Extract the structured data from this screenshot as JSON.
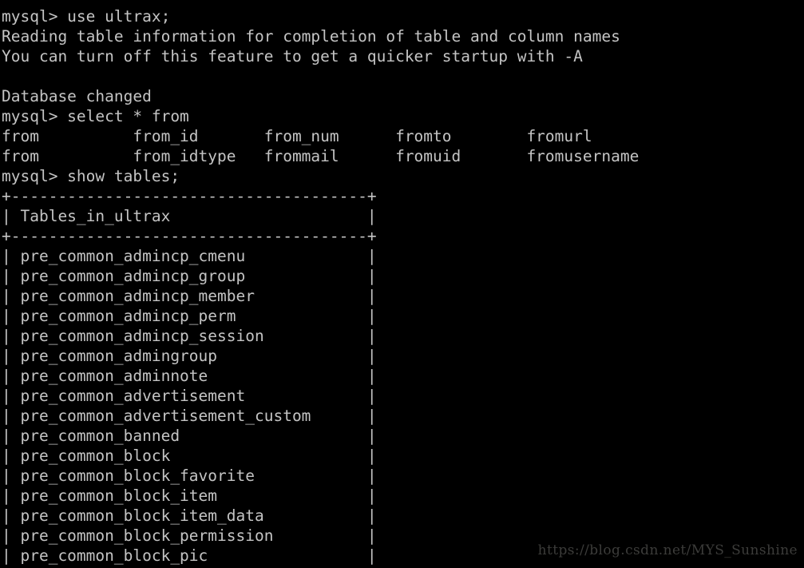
{
  "terminal": {
    "app": "mysql-client-terminal",
    "background_color": "#000000",
    "foreground_color": "#c4c4c4",
    "prompt": "mysql>",
    "lines": [
      "mysql> use ultrax;",
      "Reading table information for completion of table and column names",
      "You can turn off this feature to get a quicker startup with -A",
      "",
      "Database changed",
      "mysql> select * from",
      "from          from_id       from_num      fromto        fromurl",
      "from          from_idtype   frommail      fromuid       fromusername",
      "mysql> show tables;",
      "+--------------------------------------+",
      "| Tables_in_ultrax                     |",
      "+--------------------------------------+",
      "| pre_common_admincp_cmenu             |",
      "| pre_common_admincp_group             |",
      "| pre_common_admincp_member            |",
      "| pre_common_admincp_perm              |",
      "| pre_common_admincp_session           |",
      "| pre_common_admingroup                |",
      "| pre_common_adminnote                 |",
      "| pre_common_advertisement             |",
      "| pre_common_advertisement_custom      |",
      "| pre_common_banned                    |",
      "| pre_common_block                     |",
      "| pre_common_block_favorite            |",
      "| pre_common_block_item                |",
      "| pre_common_block_item_data           |",
      "| pre_common_block_permission          |",
      "| pre_common_block_pic                 |"
    ],
    "commands": [
      "use ultrax;",
      "select * from",
      "show tables;"
    ],
    "messages": [
      "Reading table information for completion of table and column names",
      "You can turn off this feature to get a quicker startup with -A",
      "Database changed"
    ],
    "completion_suggestions": {
      "row1": [
        "from",
        "from_id",
        "from_num",
        "fromto",
        "fromurl"
      ],
      "row2": [
        "from",
        "from_idtype",
        "frommail",
        "fromuid",
        "fromusername"
      ]
    },
    "result_table": {
      "column_header": "Tables_in_ultrax",
      "border": "+--------------------------------------+",
      "rows": [
        "pre_common_admincp_cmenu",
        "pre_common_admincp_group",
        "pre_common_admincp_member",
        "pre_common_admincp_perm",
        "pre_common_admincp_session",
        "pre_common_admingroup",
        "pre_common_adminnote",
        "pre_common_advertisement",
        "pre_common_advertisement_custom",
        "pre_common_banned",
        "pre_common_block",
        "pre_common_block_favorite",
        "pre_common_block_item",
        "pre_common_block_item_data",
        "pre_common_block_permission",
        "pre_common_block_pic"
      ]
    }
  },
  "watermark": {
    "text": "https://blog.csdn.net/MYS_Sunshine",
    "color": "#3c3c3a"
  }
}
